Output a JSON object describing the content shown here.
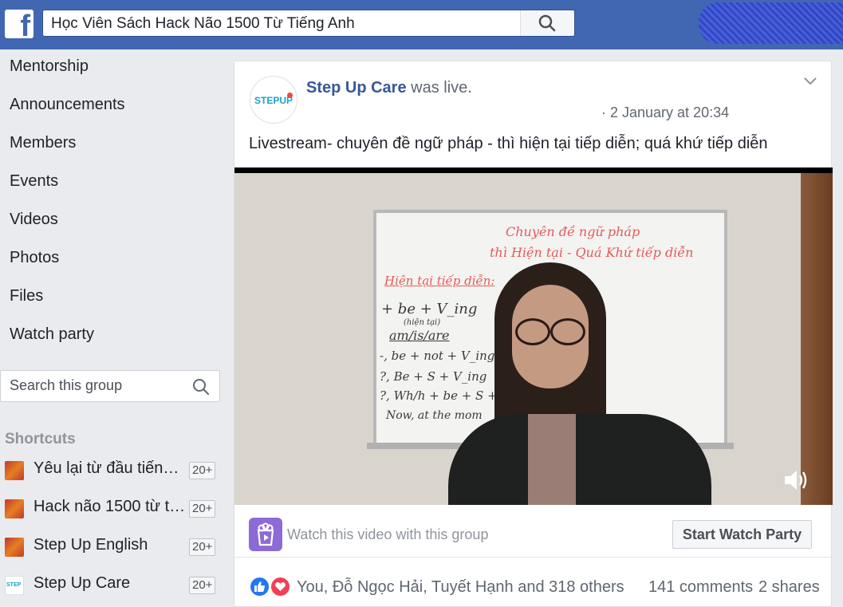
{
  "header": {
    "search_value": "Học Viên Sách Hack Não 1500 Từ Tiếng Anh",
    "logo_letter": "f"
  },
  "sidebar": {
    "nav_items": [
      {
        "label": "Mentorship"
      },
      {
        "label": "Announcements"
      },
      {
        "label": "Members"
      },
      {
        "label": "Events"
      },
      {
        "label": "Videos"
      },
      {
        "label": "Photos"
      },
      {
        "label": "Files"
      },
      {
        "label": "Watch party"
      }
    ],
    "search_placeholder": "Search this group",
    "shortcuts_title": "Shortcuts",
    "shortcuts": [
      {
        "label": "Yêu lại từ đầu tiếng…",
        "badge": "20+"
      },
      {
        "label": "Hack não 1500 từ t…",
        "badge": "20+"
      },
      {
        "label": "Step Up English",
        "badge": "20+"
      },
      {
        "label": "Step Up Care",
        "badge": "20+"
      }
    ]
  },
  "post": {
    "avatar_text": "STEPUP",
    "author": "Step Up Care",
    "action": " was live.",
    "time": "· 2 January at 20:34",
    "text": "Livestream- chuyên đề ngữ pháp - thì hiện tại tiếp diễn; quá khứ tiếp diễn",
    "whiteboard": {
      "title1": "Chuyên đề ngữ pháp",
      "title2": "thì Hiện tại - Quá Khứ tiếp diễn",
      "heading": "Hiện tại tiếp diễn:",
      "line1": "+  be + V_ing",
      "line1b": "(hiện tại)",
      "line2": "am/is/are",
      "line3": "-,  be + not + V_ing",
      "line4": "?,  Be + S + V_ing",
      "line5": "?,  Wh/h + be + S +",
      "line6": "Now, at the mom"
    }
  },
  "watch_party": {
    "text": "Watch this video with this group",
    "button_label": "Start Watch Party"
  },
  "reactions": {
    "names": "You, Đỗ Ngọc Hải, Tuyết Hạnh and 318 others",
    "comments": "141 comments",
    "shares": "2 shares"
  },
  "colors": {
    "brand": "#4267b2",
    "link": "#365899",
    "watch_party_icon": "#8c6bd6",
    "like": "#2078f4",
    "love": "#f33e58"
  }
}
